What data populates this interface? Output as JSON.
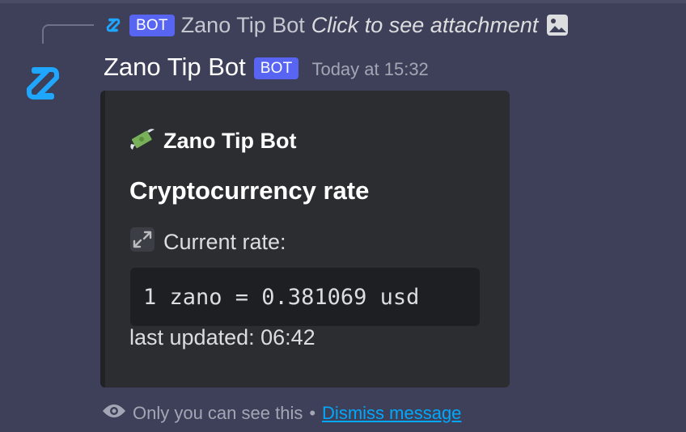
{
  "reply": {
    "bot_tag": "BOT",
    "author": "Zano Tip Bot",
    "preview": "Click to see attachment",
    "attachment_icon": "image-icon"
  },
  "message": {
    "avatar_icon": "zano-logo-icon",
    "username": "Zano Tip Bot",
    "bot_tag": "BOT",
    "timestamp": "Today at 15:32"
  },
  "embed": {
    "author_icon": "money-with-wings-icon",
    "author": "Zano Tip Bot",
    "title": "Cryptocurrency rate",
    "field_icon": "exchange-arrows-icon",
    "field_label": "Current rate:",
    "rate_code": "1 zano = 0.381069 usd",
    "last_updated": "last updated: 06:42"
  },
  "ephemeral": {
    "icon": "eye-icon",
    "text": "Only you can see this",
    "separator": "•",
    "dismiss_label": "Dismiss message"
  },
  "colors": {
    "background": "#3e4059",
    "embed_background": "#2b2d31",
    "bot_tag": "#5865f2",
    "link": "#00a8fc",
    "zano_blue": "#1fa6ff"
  }
}
